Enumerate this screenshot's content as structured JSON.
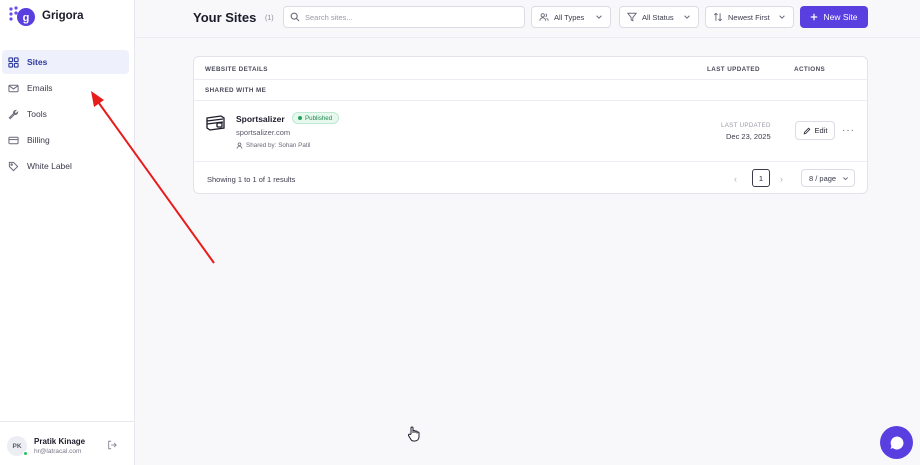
{
  "brand": {
    "name": "Grigora"
  },
  "sidebar": {
    "items": [
      {
        "label": "Sites",
        "icon": "grid-icon",
        "active": true
      },
      {
        "label": "Emails",
        "icon": "mail-icon",
        "active": false
      },
      {
        "label": "Tools",
        "icon": "wrench-icon",
        "active": false
      },
      {
        "label": "Billing",
        "icon": "credit-card-icon",
        "active": false
      },
      {
        "label": "White Label",
        "icon": "tag-icon",
        "active": false
      }
    ]
  },
  "user": {
    "initials": "PK",
    "name": "Pratik Kinage",
    "email": "hr@latracal.com",
    "status_color": "#22c55e"
  },
  "header": {
    "title": "Your Sites",
    "count": "(1)",
    "search_placeholder": "Search sites...",
    "type_filter": "All Types",
    "status_filter": "All Status",
    "sort": "Newest First",
    "new_site_label": "New Site"
  },
  "table": {
    "columns": {
      "details": "WEBSITE DETAILS",
      "updated": "LAST UPDATED",
      "actions": "ACTIONS"
    },
    "section": "SHARED WITH ME",
    "rows": [
      {
        "name": "Sportsalizer",
        "status": "Published",
        "url": "sportsalizer.com",
        "shared_by": "Shared by: Sohan Patil",
        "last_updated_label": "LAST UPDATED",
        "last_updated": "Dec 23, 2025",
        "edit_label": "Edit",
        "more_label": "···"
      }
    ],
    "footer": {
      "results": "Showing 1 to 1 of 1 results",
      "prev": "‹",
      "page": "1",
      "next": "›",
      "per_page": "8 / page"
    }
  },
  "colors": {
    "accent": "#5a3fe0",
    "annotation_arrow": "#e81b1b"
  }
}
